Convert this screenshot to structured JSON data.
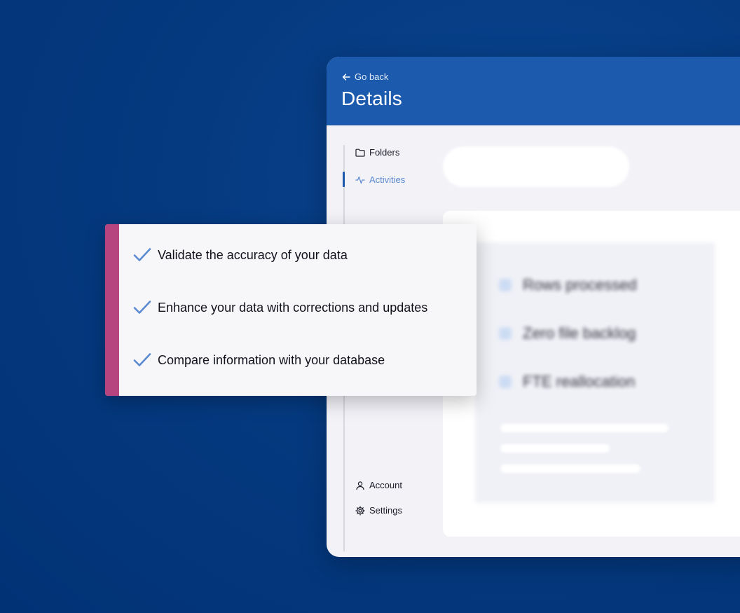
{
  "header": {
    "back_label": "Go back",
    "title": "Details"
  },
  "sidebar": {
    "items": [
      {
        "label": "Folders",
        "icon": "folder-icon",
        "active": false
      },
      {
        "label": "Activities",
        "icon": "activity-icon",
        "active": true
      }
    ],
    "bottom_items": [
      {
        "label": "Account",
        "icon": "user-icon"
      },
      {
        "label": "Settings",
        "icon": "gear-icon"
      }
    ]
  },
  "stats": {
    "items": [
      {
        "label": "Rows processed",
        "icon": "rows-icon"
      },
      {
        "label": "Zero file backlog",
        "icon": "file-icon"
      },
      {
        "label": "FTE reallocation",
        "icon": "person-icon"
      }
    ]
  },
  "features": {
    "items": [
      "Validate the accuracy of your data",
      "Enhance your data with corrections and updates",
      "Compare information with your database"
    ]
  },
  "colors": {
    "background": "#023276",
    "header": "#1b5aad",
    "accent": "#b6457f",
    "check": "#5b8ad1"
  }
}
